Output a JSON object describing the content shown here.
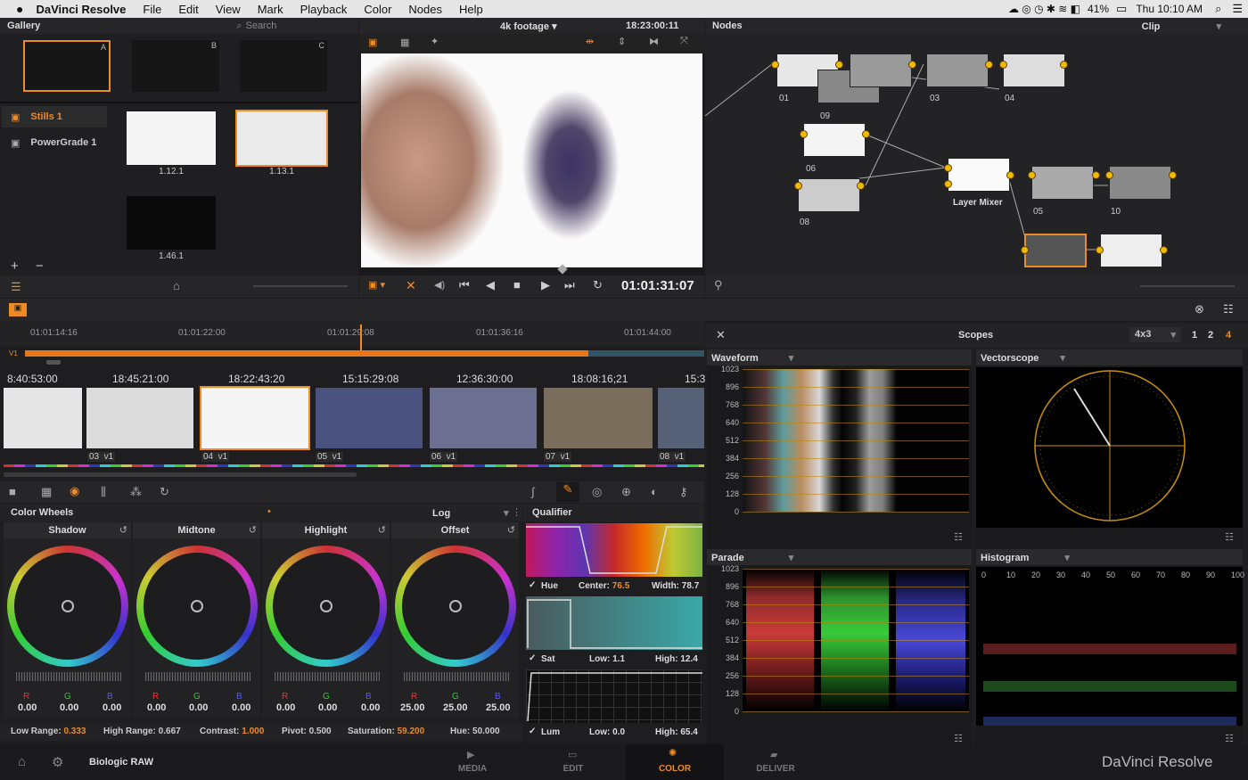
{
  "menubar": {
    "apple": "",
    "app": "DaVinci Resolve",
    "items": [
      "File",
      "Edit",
      "View",
      "Mark",
      "Playback",
      "Color",
      "Nodes",
      "Help"
    ],
    "battery": "41%",
    "clock": "Thu 10:10 AM"
  },
  "gallery": {
    "title": "Gallery",
    "search_placeholder": "Search",
    "slots": [
      "A",
      "B",
      "C"
    ],
    "albums": [
      {
        "label": "Stills 1"
      },
      {
        "label": "PowerGrade 1"
      }
    ],
    "stills": [
      "1.12.1",
      "1.13.1",
      "1.46.1"
    ]
  },
  "viewer": {
    "clip_name": "4k footage",
    "timecode_top": "18:23:00:11",
    "timecode": "01:01:31:07"
  },
  "nodes": {
    "title": "Nodes",
    "mode": "Clip",
    "labels": [
      "01",
      "09",
      "03",
      "04",
      "06",
      "08",
      "05",
      "10"
    ],
    "mixer": "Layer Mixer"
  },
  "timeline": {
    "ruler": [
      "01:01:14:16",
      "01:01:22:00",
      "01:01:29:08",
      "01:01:36:16",
      "01:01:44:00"
    ],
    "track": "V1",
    "clips": [
      {
        "tc": "8:40:53:00",
        "label": ""
      },
      {
        "tc": "18:45:21:00",
        "label": "03  v1"
      },
      {
        "tc": "18:22:43:20",
        "label": "04  v1"
      },
      {
        "tc": "15:15:29:08",
        "label": "05  v1"
      },
      {
        "tc": "12:36:30:00",
        "label": "06  v1"
      },
      {
        "tc": "18:08:16;21",
        "label": "07  v1"
      },
      {
        "tc": "15:3",
        "label": "08  v1"
      }
    ]
  },
  "scopes": {
    "title": "Scopes",
    "layout": "4x3",
    "pages": [
      "1",
      "2",
      "4"
    ],
    "waveform": "Waveform",
    "vectorscope": "Vectorscope",
    "parade": "Parade",
    "histogram": "Histogram",
    "scale": [
      "1023",
      "896",
      "768",
      "640",
      "512",
      "384",
      "256",
      "128",
      "0"
    ],
    "hist_scale": [
      "0",
      "10",
      "20",
      "30",
      "40",
      "50",
      "60",
      "70",
      "80",
      "90",
      "100"
    ]
  },
  "wheels": {
    "title": "Color Wheels",
    "mode": "Log",
    "items": [
      {
        "name": "Shadow",
        "r": "0.00",
        "g": "0.00",
        "b": "0.00"
      },
      {
        "name": "Midtone",
        "r": "0.00",
        "g": "0.00",
        "b": "0.00"
      },
      {
        "name": "Highlight",
        "r": "0.00",
        "g": "0.00",
        "b": "0.00"
      },
      {
        "name": "Offset",
        "r": "25.00",
        "g": "25.00",
        "b": "25.00"
      }
    ],
    "rgb": [
      "R",
      "G",
      "B"
    ],
    "low_range_label": "Low Range:",
    "low_range": "0.333",
    "high_range_label": "High Range:",
    "high_range": "0.667",
    "contrast_label": "Contrast:",
    "contrast": "1.000",
    "pivot_label": "Pivot:",
    "pivot": "0.500",
    "saturation_label": "Saturation:",
    "saturation": "59.200",
    "hue_label": "Hue:",
    "hue": "50.000"
  },
  "qualifier": {
    "title": "Qualifier",
    "hue": {
      "label": "Hue",
      "center_label": "Center:",
      "center": "76.5",
      "width_label": "Width:",
      "width": "78.7"
    },
    "sat": {
      "label": "Sat",
      "low_label": "Low:",
      "low": "1.1",
      "high_label": "High:",
      "high": "12.4"
    },
    "lum": {
      "label": "Lum",
      "low_label": "Low:",
      "low": "0.0",
      "high_label": "High:",
      "high": "65.4"
    }
  },
  "footer": {
    "project": "Biologic RAW",
    "tabs": [
      "MEDIA",
      "EDIT",
      "COLOR",
      "DELIVER"
    ],
    "brand": "DaVinci Resolve"
  },
  "colors": {
    "accent": "#f08a24",
    "node_dot": "#f5b800"
  }
}
